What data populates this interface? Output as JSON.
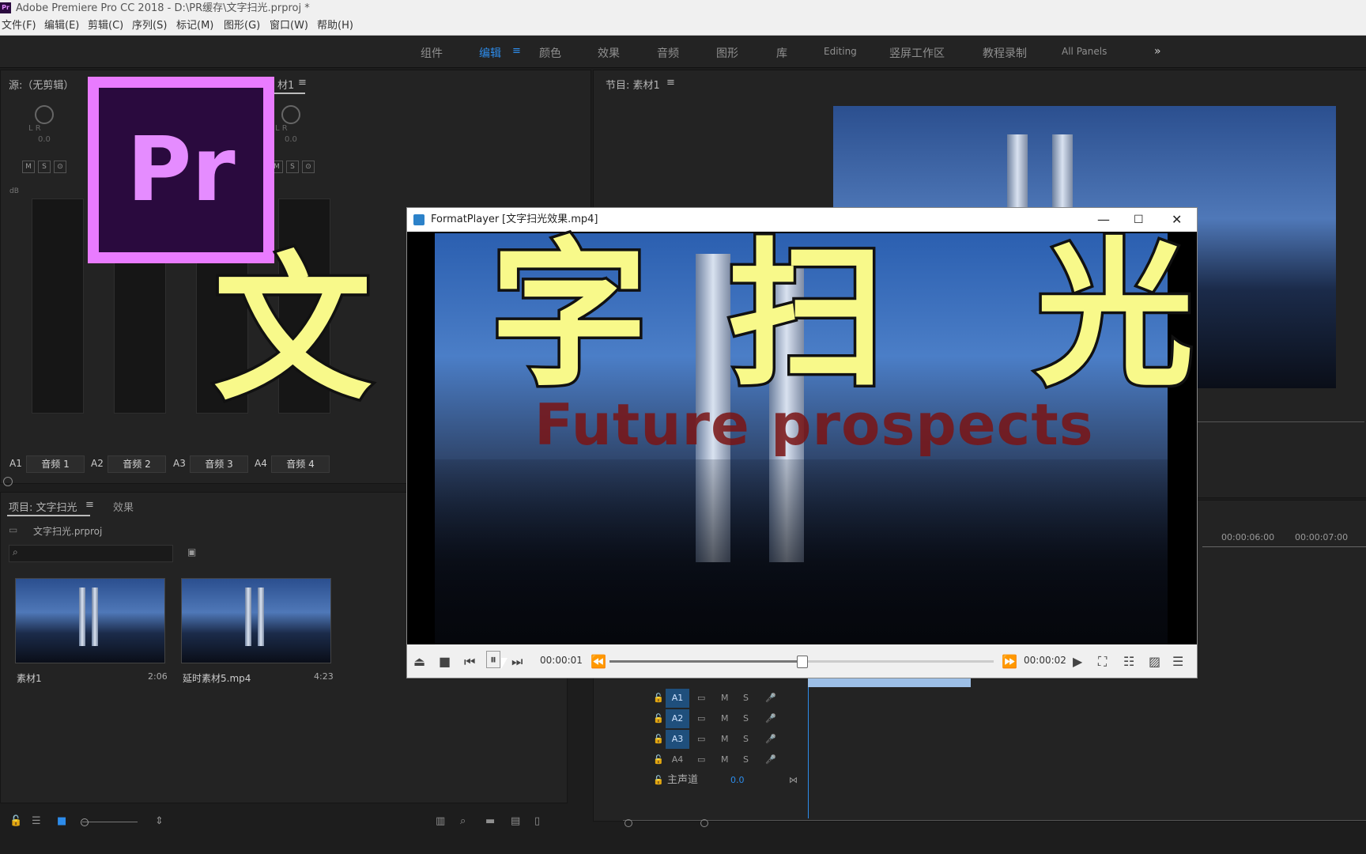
{
  "window": {
    "title": "Adobe Premiere Pro CC 2018 - D:\\PR缓存\\文字扫光.prproj *"
  },
  "menu": [
    "文件(F)",
    "编辑(E)",
    "剪辑(C)",
    "序列(S)",
    "标记(M)",
    "图形(G)",
    "窗口(W)",
    "帮助(H)"
  ],
  "workspaces": [
    "组件",
    "编辑",
    "颜色",
    "效果",
    "音频",
    "图形",
    "库",
    "Editing",
    "竖屏工作区",
    "教程录制",
    "All Panels"
  ],
  "active_workspace": "编辑",
  "source_panel": {
    "title": "源:（无剪辑）",
    "mixer_tab": "材1",
    "channels": [
      {
        "id": "A1",
        "name": "音频 1"
      },
      {
        "id": "A2",
        "name": "音频 2"
      },
      {
        "id": "A3",
        "name": "音频 3"
      },
      {
        "id": "A4",
        "name": "音频 4"
      }
    ],
    "db_label": "dB",
    "knob_lr": "L    R",
    "knob_val": "0.0"
  },
  "program_panel": {
    "title": "节目: 素材1"
  },
  "project_panel": {
    "tab_project": "项目: 文字扫光",
    "tab_effects": "效果",
    "file": "文字扫光.prproj",
    "items": [
      {
        "name": "素材1",
        "duration": "2:06"
      },
      {
        "name": "延时素材5.mp4",
        "duration": "4:23"
      }
    ]
  },
  "timeline": {
    "ruler": [
      "00:00:06:00",
      "00:00:07:00"
    ],
    "tracks": [
      {
        "id": "A1",
        "m": "M",
        "s": "S"
      },
      {
        "id": "A2",
        "m": "M",
        "s": "S"
      },
      {
        "id": "A3",
        "m": "M",
        "s": "S"
      },
      {
        "id": "A4",
        "m": "M",
        "s": "S"
      }
    ],
    "master": {
      "label": "主声道",
      "value": "0.0"
    }
  },
  "player": {
    "app": "FormatPlayer",
    "file": "[文字扫光效果.mp4]",
    "time_current": "00:00:01",
    "time_total": "00:00:02",
    "progress": 0.5,
    "video_text": "Future prospects"
  },
  "overlay": {
    "chars": [
      "文",
      "字",
      "扫",
      "光"
    ],
    "logo": "Pr"
  },
  "colors": {
    "accent": "#2d8ceb",
    "overlay_text": "#f8f98a",
    "logo_bg": "#2a0a3e",
    "logo_border": "#e97bff"
  }
}
